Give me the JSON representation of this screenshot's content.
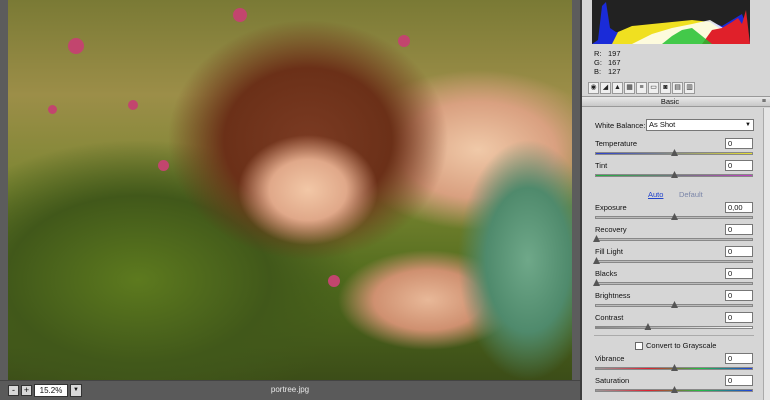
{
  "preview": {
    "filename": "portree.jpg",
    "zoom": "15.2%",
    "zoom_out_label": "-",
    "zoom_in_label": "+"
  },
  "histogram": {
    "readout": [
      {
        "label": "R:",
        "value": "197"
      },
      {
        "label": "G:",
        "value": "167"
      },
      {
        "label": "B:",
        "value": "127"
      }
    ]
  },
  "toolbar": {
    "icons": [
      "basic-tab-icon",
      "tone-curve-tab-icon",
      "detail-tab-icon",
      "hsl-tab-icon",
      "split-toning-tab-icon",
      "lens-corrections-tab-icon",
      "camera-calibration-tab-icon",
      "presets-tab-icon",
      "snapshots-tab-icon"
    ]
  },
  "panel": {
    "title": "Basic",
    "menu_icon": "≡",
    "white_balance": {
      "label": "White Balance:",
      "value": "As Shot"
    },
    "auto_label": "Auto",
    "default_label": "Default",
    "grayscale_label": "Convert to Grayscale",
    "sliders": [
      {
        "name": "temperature",
        "label": "Temperature",
        "value": "0",
        "level": 0.5
      },
      {
        "name": "tint",
        "label": "Tint",
        "value": "0",
        "level": 0.5
      },
      {
        "name": "exposure",
        "label": "Exposure",
        "value": "0,00",
        "level": 0.5
      },
      {
        "name": "recovery",
        "label": "Recovery",
        "value": "0",
        "level": 0.0
      },
      {
        "name": "fill-light",
        "label": "Fill Light",
        "value": "0",
        "level": 0.0
      },
      {
        "name": "blacks",
        "label": "Blacks",
        "value": "0",
        "level": 0.0
      },
      {
        "name": "brightness",
        "label": "Brightness",
        "value": "0",
        "level": 0.5
      },
      {
        "name": "contrast",
        "label": "Contrast",
        "value": "0",
        "level": 0.33
      },
      {
        "name": "vibrance",
        "label": "Vibrance",
        "value": "0",
        "level": 0.5
      },
      {
        "name": "saturation",
        "label": "Saturation",
        "value": "0",
        "level": 0.5
      }
    ]
  },
  "colors": {
    "accent_link": "#2244cc",
    "histogram_red": "#e0202a",
    "histogram_blue": "#1a2bd8",
    "histogram_yellow": "#f0e020"
  }
}
